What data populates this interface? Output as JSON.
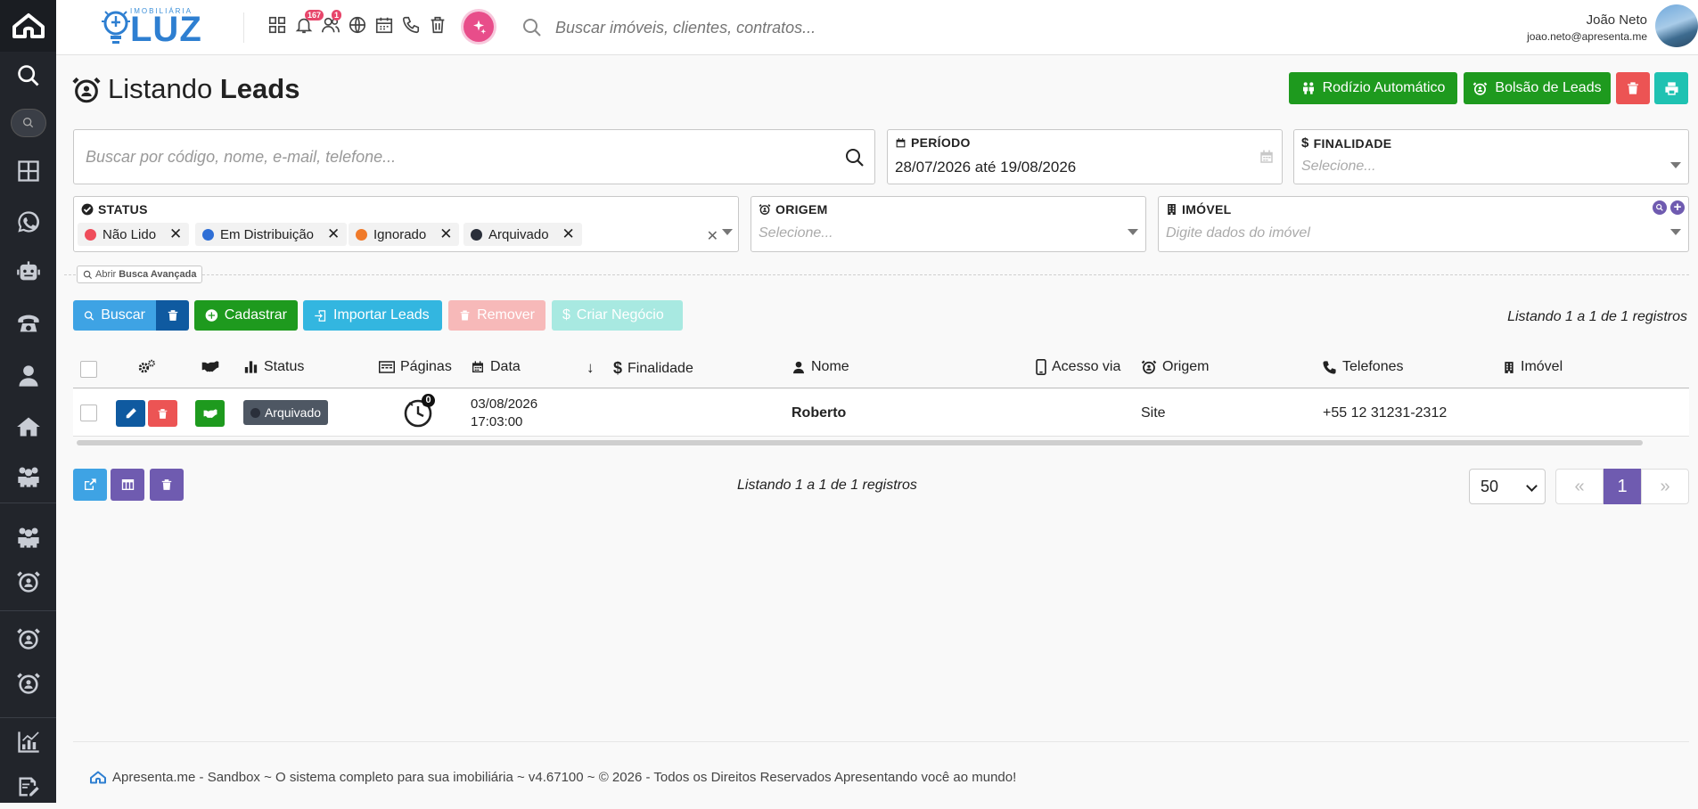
{
  "header": {
    "logo_small": "IMOBILIÁRIA",
    "logo_big": "LUZ",
    "notifications_badge": "167",
    "users_badge": "1",
    "search_placeholder": "Buscar imóveis, clientes, contratos...",
    "user_name": "João Neto",
    "user_email": "joao.neto@apresenta.me"
  },
  "sidebar": {
    "icons": [
      "home-logo-icon",
      "search-icon",
      "search-pill-icon",
      "dashboard-icon",
      "whatsapp-icon",
      "robot-icon",
      "phone-icon",
      "person-icon",
      "house-icon",
      "people-icon",
      "people-icon",
      "alarm-icon",
      "alarm-icon",
      "alarm-icon",
      "chart-icon",
      "signature-icon"
    ]
  },
  "page": {
    "title_prefix": "Listando",
    "title_bold": "Leads",
    "buttons": {
      "rodizio": "Rodízio Automático",
      "bolsao": "Bolsão de Leads"
    }
  },
  "filters": {
    "search_placeholder": "Buscar por código, nome, e-mail, telefone...",
    "periodo_label": "PERÍODO",
    "periodo_value": "28/07/2026 até 19/08/2026",
    "finalidade_label": "FINALIDADE",
    "finalidade_placeholder": "Selecione...",
    "status_label": "STATUS",
    "status_chips": [
      {
        "label": "Não Lido",
        "color": "#ef4d5b"
      },
      {
        "label": "Em Distribuição",
        "color": "#2f6fd6"
      },
      {
        "label": "Ignorado",
        "color": "#f07a2a"
      },
      {
        "label": "Arquivado",
        "color": "#2a2f3a"
      }
    ],
    "origem_label": "ORIGEM",
    "origem_placeholder": "Selecione...",
    "imovel_label": "IMÓVEL",
    "imovel_placeholder": "Digite dados do imóvel",
    "advanced_prefix": "Abrir",
    "advanced_bold": "Busca Avançada"
  },
  "actions": {
    "buscar": "Buscar",
    "cadastrar": "Cadastrar",
    "importar": "Importar Leads",
    "remover": "Remover",
    "criar_negocio": "Criar Negócio",
    "listing": "Listando 1 a 1 de 1 registros"
  },
  "table": {
    "columns": {
      "status": "Status",
      "paginas": "Páginas",
      "data": "Data",
      "finalidade": "Finalidade",
      "nome": "Nome",
      "acesso_via": "Acesso via",
      "origem": "Origem",
      "telefones": "Telefones",
      "imovel": "Imóvel"
    },
    "rows": [
      {
        "status": "Arquivado",
        "paginas": "0",
        "date": "03/08/2026",
        "time": "17:03:00",
        "finalidade": "",
        "nome": "Roberto",
        "acesso_via": "",
        "origem": "Site",
        "telefones": "+55 12 31231-2312",
        "imovel": ""
      }
    ]
  },
  "pagination": {
    "listing": "Listando 1 a 1 de 1 registros",
    "per_page": "50",
    "current_page": "1",
    "prev": "«",
    "next": "»"
  },
  "footer": {
    "text": "Apresenta.me - Sandbox ~ O sistema completo para sua imobiliária ~ v4.67100 ~ © 2026 - Todos os Direitos Reservados Apresentando você ao mundo!"
  }
}
